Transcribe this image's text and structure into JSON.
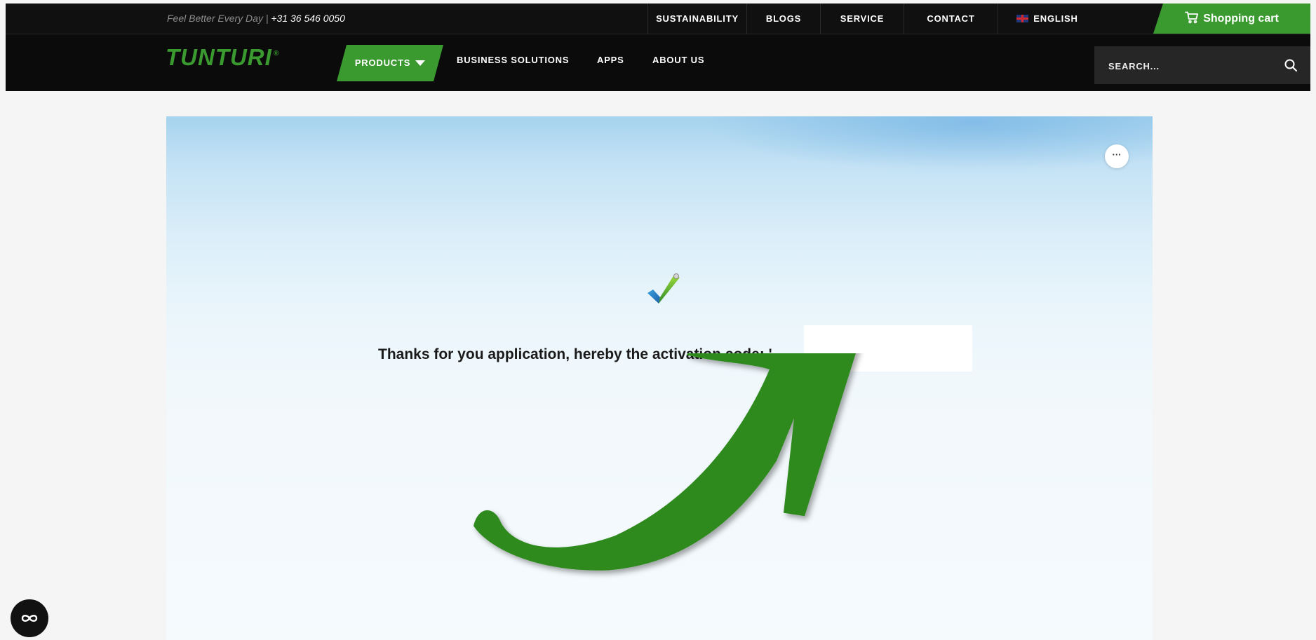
{
  "topbar": {
    "tagline": "Feel Better Every Day",
    "separator": "|",
    "phone": "+31 36 546 0050",
    "nav": [
      "SUSTAINABILITY",
      "BLOGS",
      "SERVICE",
      "CONTACT"
    ],
    "language": "ENGLISH",
    "cart_label": "Shopping cart"
  },
  "mainnav": {
    "logo": "TUNTURI",
    "logo_mark": "®",
    "products_label": "PRODUCTS",
    "items": [
      "BUSINESS SOLUTIONS",
      "APPS",
      "ABOUT US"
    ],
    "search_placeholder": "SEARCH..."
  },
  "content": {
    "more_label": "···",
    "message": "Thanks for you application, hereby the activation code: ",
    "code_prefix": "'"
  },
  "colors": {
    "brand_green": "#3a9a2f",
    "annotation_green": "#2d8a1c",
    "nav_background": "#0b0b0b"
  },
  "icons": {
    "cart": "cart-icon",
    "search": "search-icon",
    "check": "checkmark-icon",
    "arrow": "annotation-arrow",
    "accessibility": "infinity-icon"
  }
}
